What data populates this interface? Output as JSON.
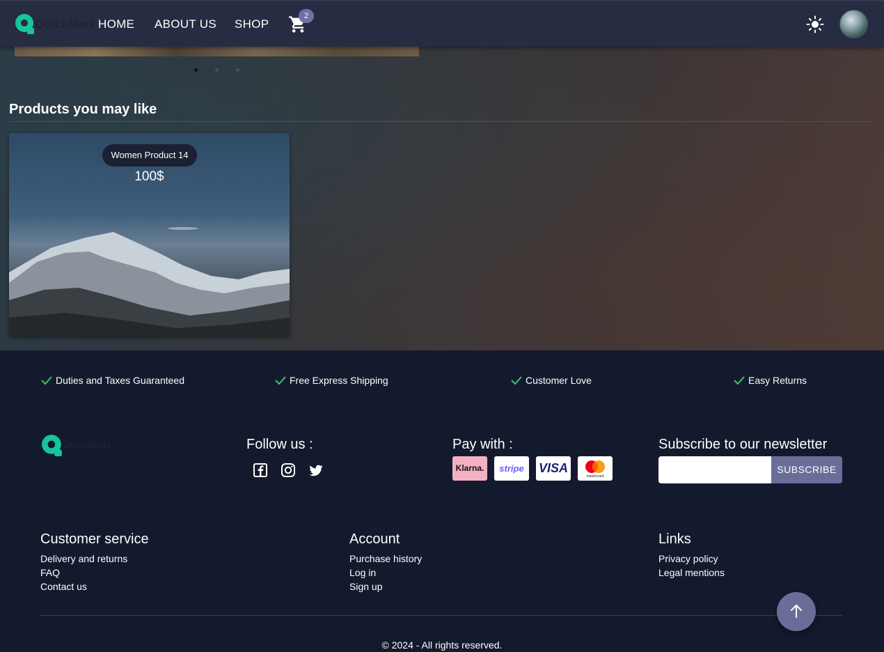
{
  "brand": {
    "name": "QuickMart",
    "accent": "#17c49b"
  },
  "nav": {
    "links": [
      "HOME",
      "ABOUT US",
      "SHOP"
    ],
    "cart_count": "2",
    "theme_icon": "sun-icon",
    "cart_icon": "cart-icon"
  },
  "carousel": {
    "dots": 3,
    "active_dot": 0
  },
  "section": {
    "title": "Products you may like"
  },
  "products": [
    {
      "name": "Women Product 14",
      "price": "100$"
    }
  ],
  "features": [
    "Duties and Taxes Guaranteed",
    "Free Express Shipping",
    "Customer Love",
    "Easy Returns"
  ],
  "footer": {
    "follow_title": "Follow us :",
    "social_icons": [
      "facebook-icon",
      "instagram-icon",
      "twitter-icon"
    ],
    "pay_title": "Pay with :",
    "pay_methods": [
      "Klarna.",
      "stripe",
      "VISA",
      "mastercard"
    ],
    "newsletter_title": "Subscribe to our newsletter",
    "newsletter_placeholder": "",
    "subscribe_label": "SUBSCRIBE",
    "columns": [
      {
        "title": "Customer service",
        "links": [
          "Delivery and returns",
          "FAQ",
          "Contact us"
        ]
      },
      {
        "title": "Account",
        "links": [
          "Purchase history",
          "Log in",
          "Sign up"
        ]
      },
      {
        "title": "Links",
        "links": [
          "Privacy policy",
          "Legal mentions"
        ]
      }
    ],
    "copyright": "© 2024 - All rights reserved."
  },
  "colors": {
    "navbar": "#262d42",
    "footer": "#141a2e",
    "button": "#6b6d99",
    "check": "#3dc46a"
  }
}
